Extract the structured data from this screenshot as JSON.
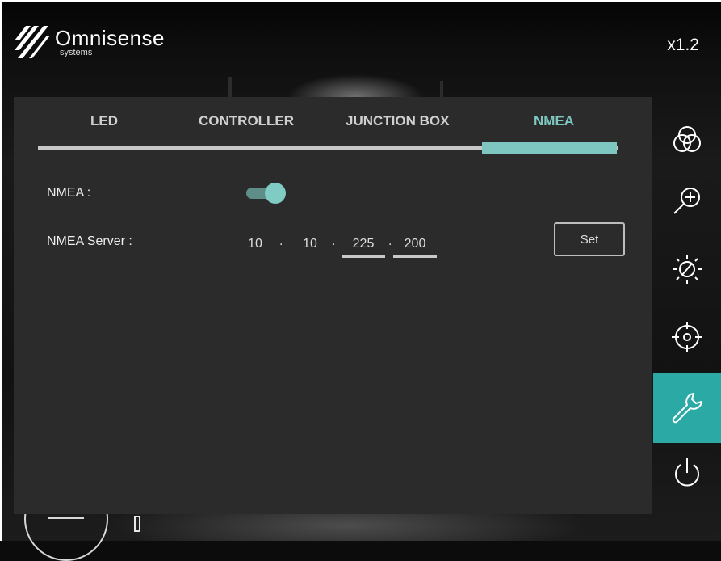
{
  "brand": {
    "name": "Omnisense",
    "sub": "systems"
  },
  "zoom_level": "x1.2",
  "tabs": [
    {
      "label": "LED",
      "active": false
    },
    {
      "label": "CONTROLLER",
      "active": false
    },
    {
      "label": "JUNCTION BOX",
      "active": false
    },
    {
      "label": "NMEA",
      "active": true
    }
  ],
  "nmea": {
    "label": "NMEA :",
    "enabled": true,
    "server_label": "NMEA Server :",
    "ip": [
      "10",
      "10",
      "225",
      "200"
    ],
    "ip_separator": ".",
    "set_label": "Set"
  },
  "toolbar": [
    {
      "icon": "color-circles-icon",
      "active": false
    },
    {
      "icon": "zoom-in-icon",
      "active": false
    },
    {
      "icon": "brightness-icon",
      "active": false
    },
    {
      "icon": "crosshair-icon",
      "active": false
    },
    {
      "icon": "wrench-icon",
      "active": true
    },
    {
      "icon": "power-icon",
      "active": false
    }
  ],
  "colors": {
    "accent": "#7dc7c0",
    "active_tool": "#2aa9a5",
    "panel": "#2b2b2b"
  }
}
